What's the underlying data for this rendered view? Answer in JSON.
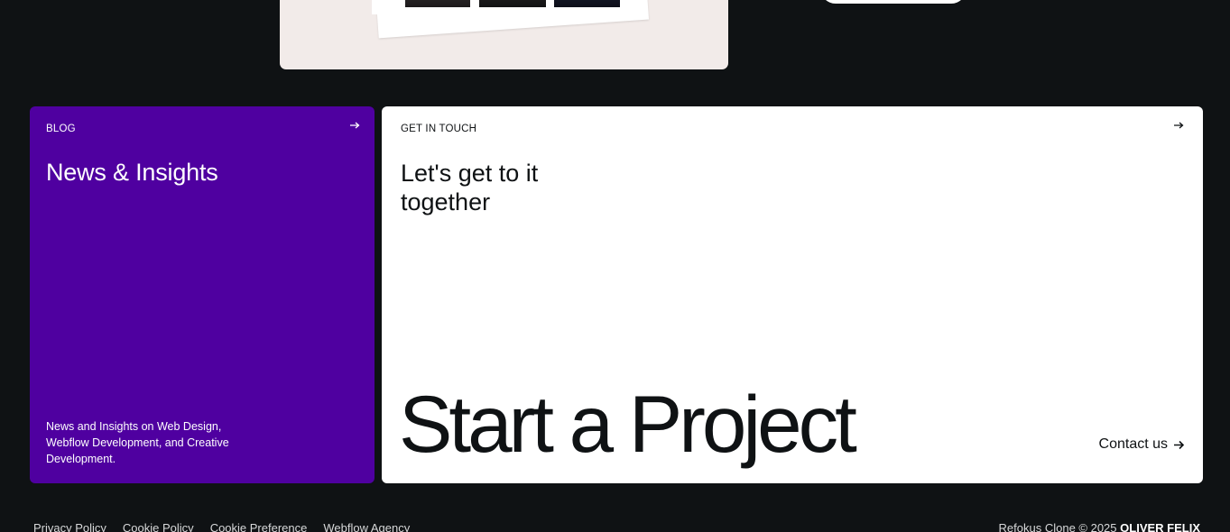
{
  "blog": {
    "eyebrow": "BLOG",
    "title": "News & Insights",
    "description": "News and Insights on Web Design, Webflow Development, and Creative Development."
  },
  "contact": {
    "eyebrow": "GET IN TOUCH",
    "title": "Let's get to it together",
    "headline": "Start a Project",
    "button_label": "Contact us"
  },
  "footer": {
    "links": [
      "Privacy Policy",
      "Cookie Policy",
      "Cookie Preference",
      "Webflow Agency"
    ],
    "copyright": "Refokus Clone © 2025",
    "author": "OLIVER FELIX"
  },
  "icons": {
    "card_arrow": "arrow-right-icon",
    "contact_arrow": "arrow-right-icon"
  },
  "colors": {
    "background": "#0f1214",
    "blog_card": "#4f00a0",
    "contact_card": "#ffffff",
    "showcase_card": "#f2ebe9"
  }
}
